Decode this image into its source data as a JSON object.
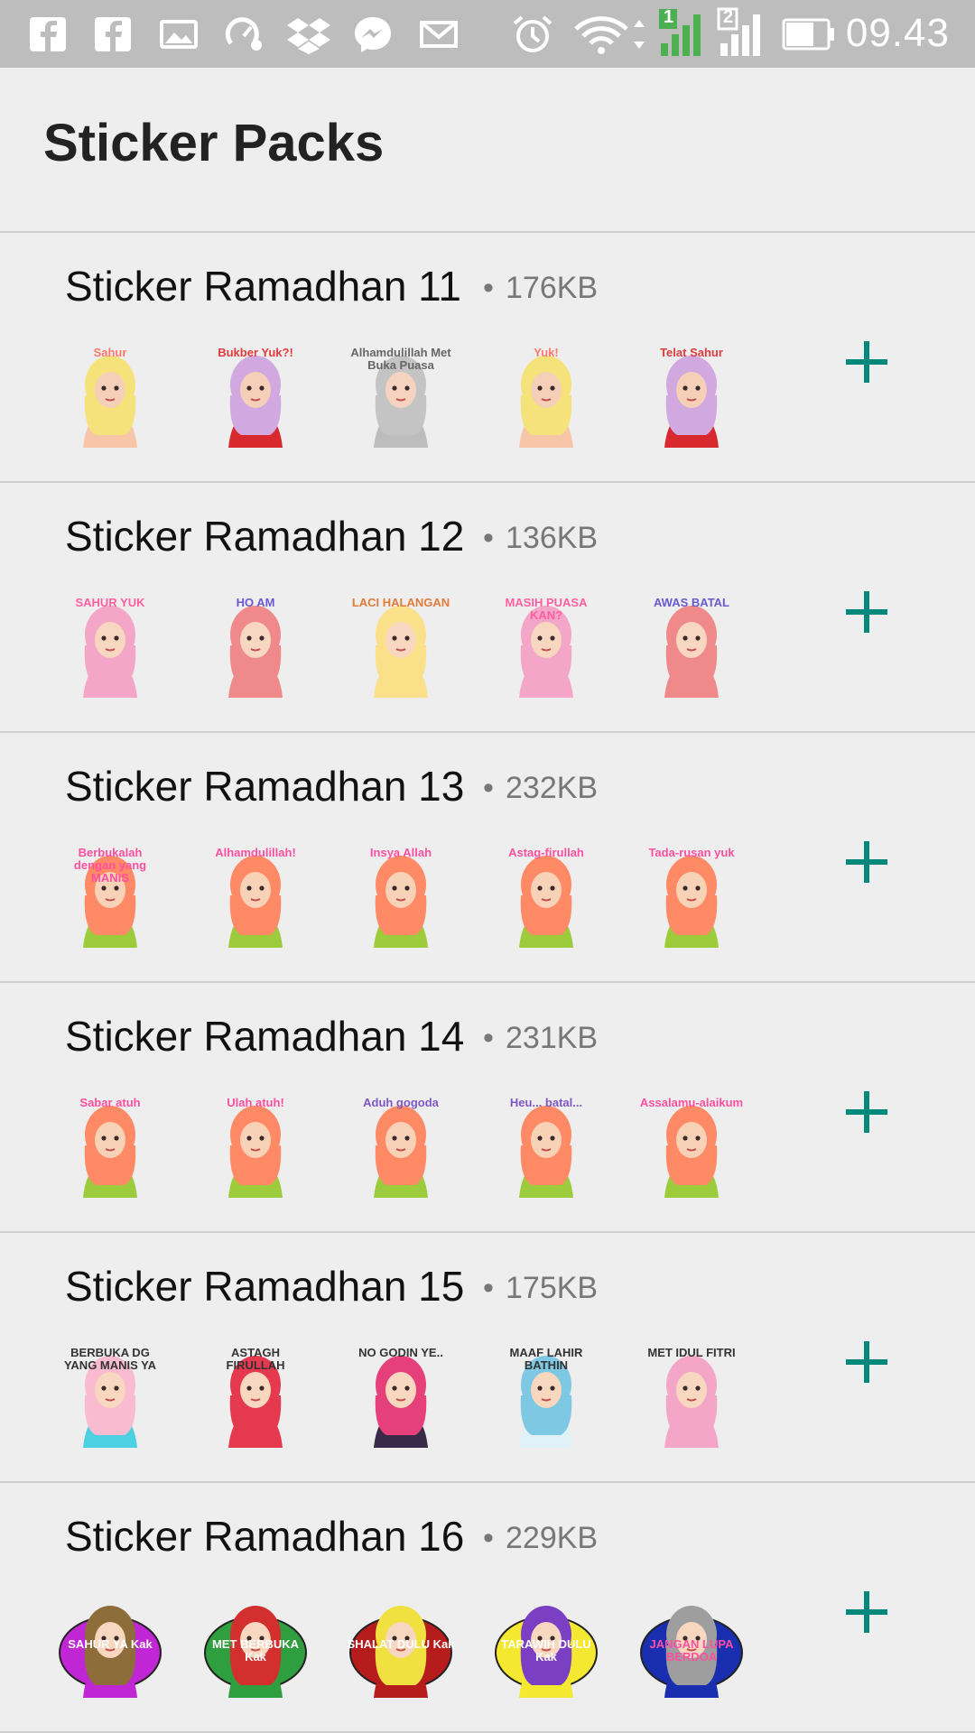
{
  "status_bar": {
    "time": "09.43",
    "icons": [
      "facebook-icon",
      "facebook-icon",
      "image-icon",
      "speed-icon",
      "dropbox-icon",
      "messenger-icon",
      "mail-icon",
      "alarm-icon",
      "wifi-icon",
      "signal-1-icon",
      "signal-2-icon",
      "battery-icon"
    ],
    "sim1": "1",
    "sim2": "2"
  },
  "page": {
    "title": "Sticker Packs"
  },
  "colors": {
    "accent": "#00897b",
    "background": "#eeeeee"
  },
  "packs": [
    {
      "name": "Sticker Ramadhan 11",
      "size": "176KB",
      "stickers": [
        {
          "caption": "Sahur",
          "hijab": "#f6e27a",
          "skin": "#f5cfb8",
          "cloth": "#f7c6a8",
          "text": "#ff7a6b"
        },
        {
          "caption": "Bukber Yuk?!",
          "hijab": "#d1a8e0",
          "skin": "#f5cfb8",
          "cloth": "#d8292f",
          "text": "#e23a3a"
        },
        {
          "caption": "Alhamdulillah Met Buka Puasa",
          "hijab": "#c4c4c4",
          "skin": "#f5d3c0",
          "cloth": "#bdbdbd",
          "text": "#666666"
        },
        {
          "caption": "Yuk!",
          "hijab": "#f6e27a",
          "skin": "#f5cfb8",
          "cloth": "#f7c6a8",
          "text": "#ff7a6b"
        },
        {
          "caption": "Telat Sahur",
          "hijab": "#d1a8e0",
          "skin": "#f5cfb8",
          "cloth": "#d8292f",
          "text": "#e23a3a"
        }
      ]
    },
    {
      "name": "Sticker Ramadhan 12",
      "size": "136KB",
      "stickers": [
        {
          "caption": "SAHUR YUK",
          "hijab": "#f4a6c8",
          "skin": "#f7d7bf",
          "cloth": "#f4a6c8",
          "text": "#ff5fa2"
        },
        {
          "caption": "HO AM",
          "hijab": "#f08a8a",
          "skin": "#f7d7bf",
          "cloth": "#f08a8a",
          "text": "#6a5acd"
        },
        {
          "caption": "LACI HALANGAN",
          "hijab": "#fbe08a",
          "skin": "#f7d7bf",
          "cloth": "#fbe08a",
          "text": "#e07b39"
        },
        {
          "caption": "MASIH PUASA KAN?",
          "hijab": "#f4a6c8",
          "skin": "#f7d7bf",
          "cloth": "#f4a6c8",
          "text": "#ff5fa2"
        },
        {
          "caption": "AWAS BATAL",
          "hijab": "#f08a8a",
          "skin": "#f7d7bf",
          "cloth": "#f08a8a",
          "text": "#6a5acd"
        }
      ]
    },
    {
      "name": "Sticker Ramadhan 13",
      "size": "232KB",
      "stickers": [
        {
          "caption": "Berbukalah dengan yang MANIS",
          "hijab": "#ff8a65",
          "skin": "#f7d2b6",
          "cloth": "#9ccc3c",
          "text": "#ff4fa0"
        },
        {
          "caption": "Alhamdulillah!",
          "hijab": "#ff8a65",
          "skin": "#f7d2b6",
          "cloth": "#9ccc3c",
          "text": "#ff4fa0"
        },
        {
          "caption": "Insya Allah",
          "hijab": "#ff8a65",
          "skin": "#f7d2b6",
          "cloth": "#9ccc3c",
          "text": "#ff4fa0"
        },
        {
          "caption": "Astag-firullah",
          "hijab": "#ff8a65",
          "skin": "#f7d2b6",
          "cloth": "#9ccc3c",
          "text": "#ff4fa0"
        },
        {
          "caption": "Tada-rusan yuk",
          "hijab": "#ff8a65",
          "skin": "#f7d2b6",
          "cloth": "#9ccc3c",
          "text": "#ff4fa0"
        }
      ]
    },
    {
      "name": "Sticker Ramadhan 14",
      "size": "231KB",
      "stickers": [
        {
          "caption": "Sabar atuh",
          "hijab": "#ff8a65",
          "skin": "#f7d2b6",
          "cloth": "#9ccc3c",
          "text": "#ff4fa0"
        },
        {
          "caption": "Ulah atuh!",
          "hijab": "#ff8a65",
          "skin": "#f7d2b6",
          "cloth": "#9ccc3c",
          "text": "#ff4fa0"
        },
        {
          "caption": "Aduh gogoda",
          "hijab": "#ff8a65",
          "skin": "#f7d2b6",
          "cloth": "#9ccc3c",
          "text": "#7e57c2"
        },
        {
          "caption": "Heu... batal...",
          "hijab": "#ff8a65",
          "skin": "#f7d2b6",
          "cloth": "#9ccc3c",
          "text": "#7e57c2"
        },
        {
          "caption": "Assalamu-alaikum",
          "hijab": "#ff8a65",
          "skin": "#f7d2b6",
          "cloth": "#9ccc3c",
          "text": "#ff4fa0"
        }
      ]
    },
    {
      "name": "Sticker Ramadhan 15",
      "size": "175KB",
      "stickers": [
        {
          "caption": "BERBUKA DG YANG MANIS YA",
          "hijab": "#f8bbd0",
          "skin": "#f7d7bf",
          "cloth": "#4dd0e1",
          "text": "#333333"
        },
        {
          "caption": "ASTAGH FIRULLAH",
          "hijab": "#e53950",
          "skin": "#f7d7bf",
          "cloth": "#e53950",
          "text": "#333333"
        },
        {
          "caption": "NO GODIN YE..",
          "hijab": "#e6407a",
          "skin": "#f7d7bf",
          "cloth": "#3a2a4a",
          "text": "#333333"
        },
        {
          "caption": "MAAF LAHIR BATHIN",
          "hijab": "#7ec8e3",
          "skin": "#f7d7bf",
          "cloth": "#e0f2f7",
          "text": "#333333"
        },
        {
          "caption": "MET IDUL FITRI",
          "hijab": "#f4a6c8",
          "skin": "#f7d7bf",
          "cloth": "#f4a6c8",
          "text": "#333333"
        }
      ]
    },
    {
      "name": "Sticker Ramadhan 16",
      "size": "229KB",
      "stickers": [
        {
          "caption": "SAHUR YA Kak",
          "hijab": "#8d6e3a",
          "skin": "#f7d7bf",
          "cloth": "#c026d3",
          "text": "#ffffff",
          "bg": "#c026d3"
        },
        {
          "caption": "MET BERBUKA Kak",
          "hijab": "#d32f2f",
          "skin": "#f7d7bf",
          "cloth": "#2e9e3e",
          "text": "#ffffff",
          "bg": "#2e9e3e"
        },
        {
          "caption": "SHALAT DULU Kak",
          "hijab": "#f0e040",
          "skin": "#f7d7bf",
          "cloth": "#b71c1c",
          "text": "#ffffff",
          "bg": "#b71c1c"
        },
        {
          "caption": "TARAWIH DULU Kak",
          "hijab": "#7b3fc4",
          "skin": "#f7d7bf",
          "cloth": "#f5e830",
          "text": "#ffffff",
          "bg": "#f5e830"
        },
        {
          "caption": "JANGAN LUPA BERDOA",
          "hijab": "#9e9e9e",
          "skin": "#f7d7bf",
          "cloth": "#1a2fb0",
          "text": "#ff4fa0",
          "bg": "#1a2fb0"
        }
      ]
    }
  ]
}
